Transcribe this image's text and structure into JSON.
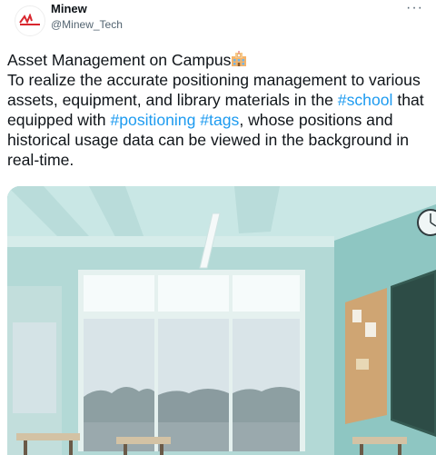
{
  "author": {
    "display_name": "Minew",
    "handle": "@Minew_Tech",
    "avatar_icon": "minew-logo-icon"
  },
  "menu": {
    "more_label": "···"
  },
  "tweet": {
    "title": "Asset Management on Campus",
    "body_1": "To realize the accurate positioning management to various assets, equipment, and library materials in the",
    "hashtag_school": "#school",
    "body_2": "that equipped with",
    "hashtag_positioning": "#positioning",
    "hashtag_tags": "#tags",
    "body_3": ", whose positions and historical usage data can be viewed in the background in real-time."
  },
  "media": {
    "description_icon": "classroom-image"
  },
  "colors": {
    "link": "#1d9bf0",
    "text": "#0f1419",
    "muted": "#536471",
    "brand": "#d8262e"
  }
}
